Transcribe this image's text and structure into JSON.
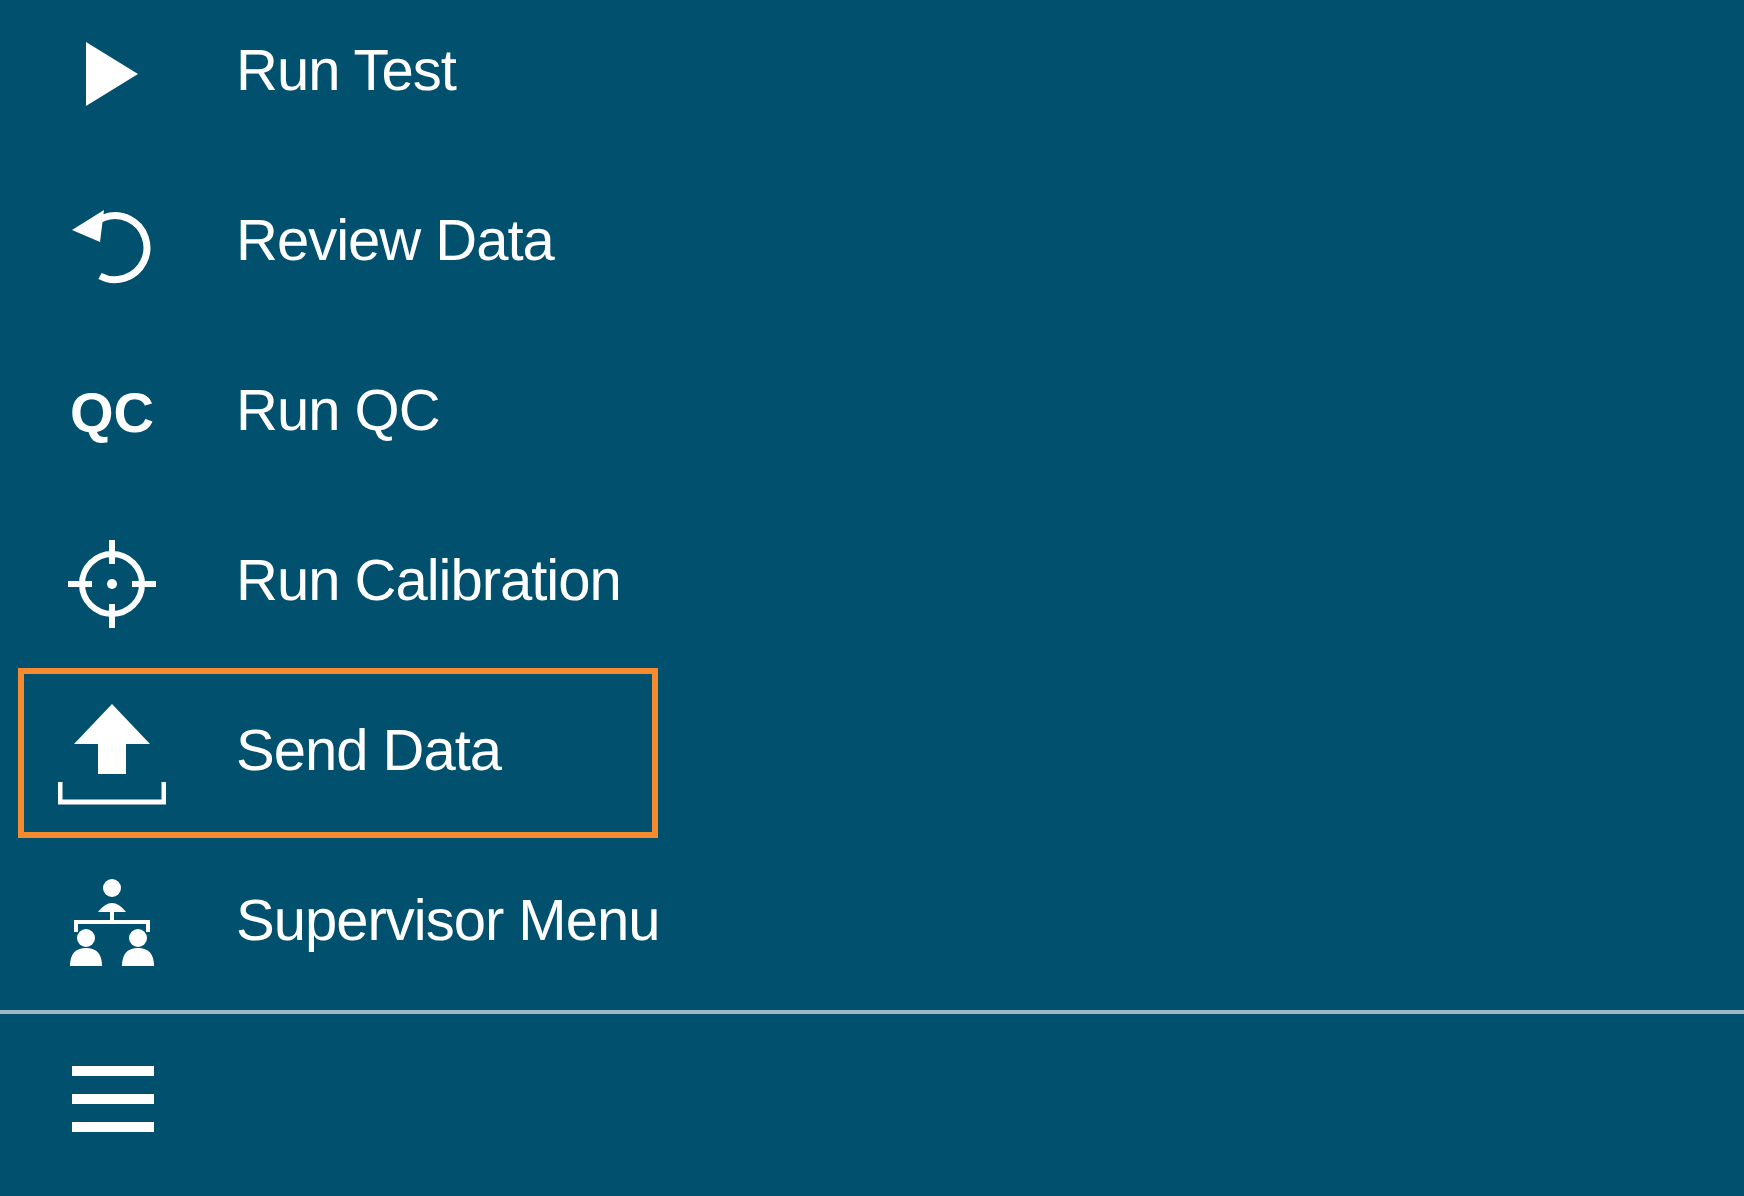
{
  "menu": {
    "items": [
      {
        "label": "Run Test",
        "selected": false
      },
      {
        "label": "Review Data",
        "selected": false
      },
      {
        "label": "Run QC",
        "icon_text": "QC",
        "selected": false
      },
      {
        "label": "Run Calibration",
        "selected": false
      },
      {
        "label": "Send Data",
        "selected": true
      },
      {
        "label": "Supervisor Menu",
        "selected": false
      }
    ]
  }
}
